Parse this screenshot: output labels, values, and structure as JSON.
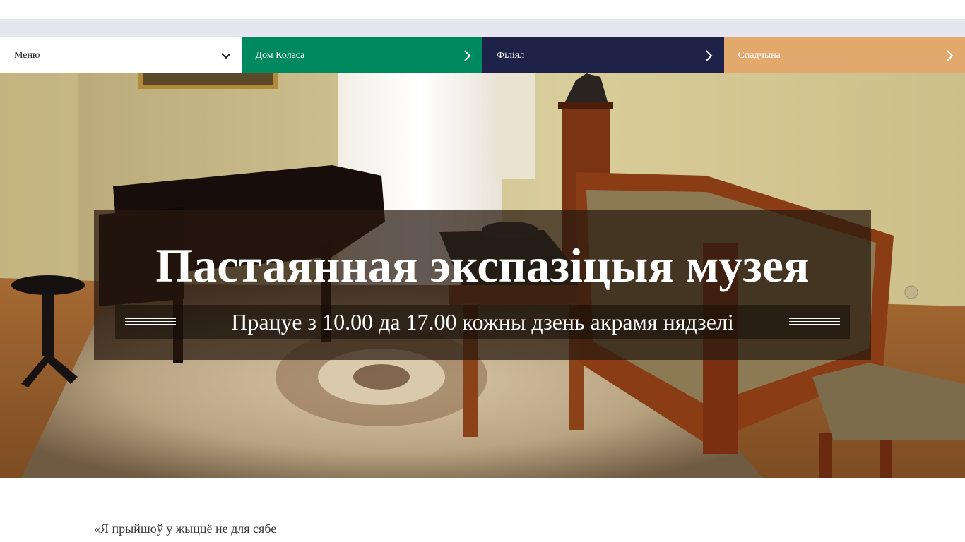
{
  "nav": {
    "menu_label": "Меню",
    "items": [
      {
        "label": "Дом Коласа",
        "color": "#00885f"
      },
      {
        "label": "Філіял",
        "color": "#1e2148"
      },
      {
        "label": "Спадчына",
        "color": "#e3a86b"
      }
    ]
  },
  "hero": {
    "title": "Пастаянная экспазіцыя музея",
    "subtitle": "Працуе з 10.00 да 17.00 кожны дзень акрамя нядзелі"
  },
  "content": {
    "quote": "«Я прыйшоў у жыццё не для сябе"
  },
  "colors": {
    "grey_strip": "#e6e6f0",
    "title_overlay": "rgba(40,25,15,0.72)"
  }
}
